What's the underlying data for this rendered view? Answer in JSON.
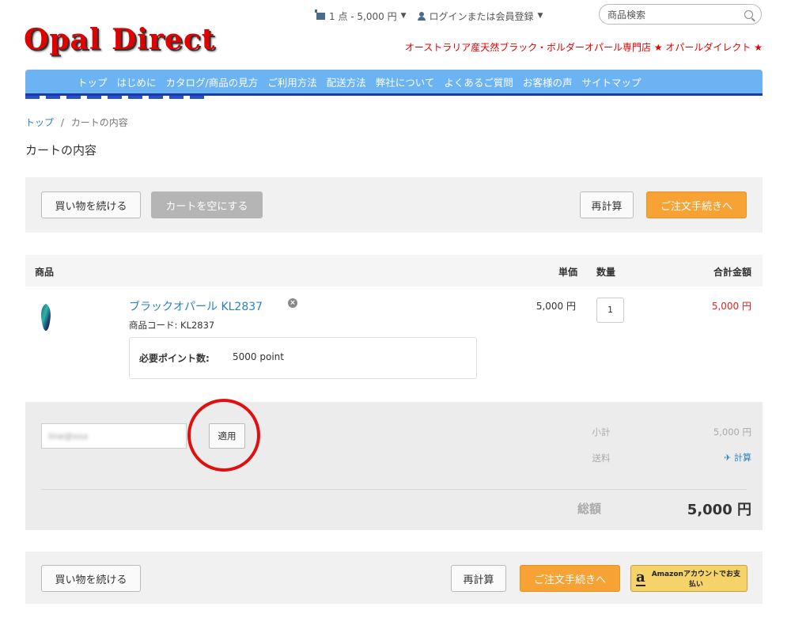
{
  "header": {
    "logo": "Opal Direct",
    "cart_indicator": "1 点 - 5,000 円",
    "login": "ログインまたは会員登録",
    "search_placeholder": "商品検索",
    "tagline": "オーストラリア産天然ブラック・ボルダーオパール専門店 ★ オパールダイレクト ★"
  },
  "nav": {
    "items": [
      "トップ",
      "はじめに",
      "カタログ/商品の見方",
      "ご利用方法",
      "配送方法",
      "弊社について",
      "よくあるご質問",
      "お客様の声",
      "サイトマップ"
    ]
  },
  "breadcrumb": {
    "home": "トップ",
    "separator": "/",
    "current": "カートの内容"
  },
  "page_title": "カートの内容",
  "top_actions": {
    "continue": "買い物を続ける",
    "empty": "カートを空にする",
    "recalc": "再計算",
    "checkout": "ご注文手続きへ"
  },
  "table": {
    "headers": {
      "product": "商品",
      "unit_price": "単価",
      "qty": "数量",
      "total": "合計金額"
    },
    "items": [
      {
        "name": "ブラックオパール KL2837",
        "sku": "商品コード: KL2837",
        "points_label": "必要ポイント数:",
        "points_value": "5000 point",
        "unit_price": "5,000 円",
        "qty": "1",
        "total": "5,000 円"
      }
    ]
  },
  "summary": {
    "coupon_value": "line@xxx",
    "apply": "適用",
    "subtotal_label": "小計",
    "subtotal_value": "5,000 円",
    "shipping_label": "送料",
    "shipping_link": "計算",
    "total_label": "総額",
    "total_value": "5,000 円"
  },
  "bottom_actions": {
    "continue": "買い物を続ける",
    "recalc": "再計算",
    "checkout": "ご注文手続きへ",
    "amazon": "Amazonアカウントでお支払い"
  },
  "colors": {
    "brand_red": "#e00000",
    "nav_blue": "#6bb3f2",
    "accent_orange": "#f7a234",
    "link_blue": "#2b80c4"
  }
}
